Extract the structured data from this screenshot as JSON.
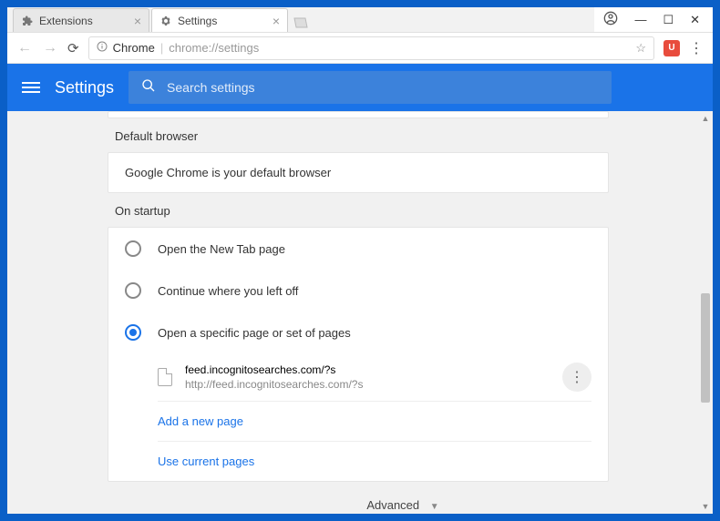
{
  "window": {
    "tabs": [
      {
        "title": "Extensions"
      },
      {
        "title": "Settings"
      }
    ],
    "controls": {
      "minimize": "—",
      "maximize": "☐",
      "close": "✕"
    }
  },
  "addressbar": {
    "site_label": "Chrome",
    "url": "chrome://settings"
  },
  "header": {
    "title": "Settings",
    "search_placeholder": "Search settings"
  },
  "sections": {
    "default_browser": {
      "title": "Default browser",
      "message": "Google Chrome is your default browser"
    },
    "startup": {
      "title": "On startup",
      "options": {
        "new_tab": "Open the New Tab page",
        "continue": "Continue where you left off",
        "specific": "Open a specific page or set of pages"
      },
      "page": {
        "title": "feed.incognitosearches.com/?s",
        "url": "http://feed.incognitosearches.com/?s"
      },
      "add_link": "Add a new page",
      "use_current_link": "Use current pages"
    }
  },
  "advanced_label": "Advanced"
}
